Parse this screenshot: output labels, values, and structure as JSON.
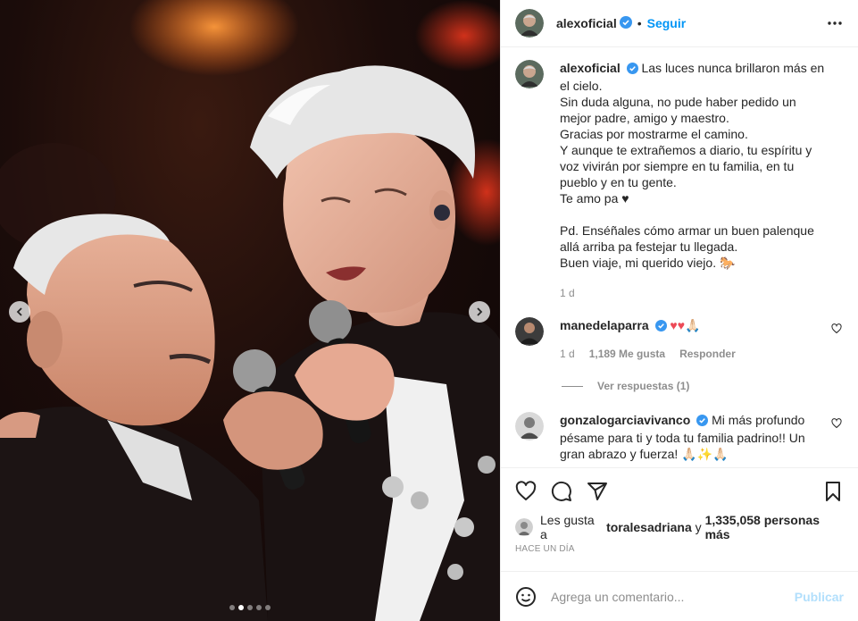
{
  "post": {
    "username": "alexoficial",
    "follow_label": "Seguir",
    "separator": "•",
    "more_icon": "more-horizontal-icon",
    "media": {
      "carousel_dots": 5,
      "active_dot": 2,
      "prev_icon": "chevron-left-icon",
      "next_icon": "chevron-right-icon"
    }
  },
  "caption": {
    "username": "alexoficial",
    "lines": [
      "Las luces nunca brillaron más en el cielo.",
      "Sin duda alguna, no pude haber pedido un mejor padre, amigo y maestro.",
      "Gracias por mostrarme el camino.",
      "Y aunque te extrañemos a diario, tu espíritu y voz vivirán por siempre en tu familia, en tu pueblo y en tu gente.",
      "Te amo pa ♥"
    ],
    "lines2": [
      "Pd. Enséñales cómo armar un buen palenque allá arriba pa festejar tu llegada.",
      "Buen viaje, mi querido viejo. 🐎"
    ],
    "time": "1 d"
  },
  "comments": [
    {
      "username": "manedelaparra",
      "text": "♥♥🙏🏻",
      "time": "1 d",
      "likes": "1,189 Me gusta",
      "reply": "Responder",
      "view_replies": "Ver respuestas (1)"
    },
    {
      "username": "gonzalogarciavivanco",
      "text": "Mi más profundo pésame para ti y toda tu familia padrino!! Un gran abrazo y fuerza! 🙏🏻✨🙏🏻"
    }
  ],
  "likes": {
    "prefix": "Les gusta a",
    "user": "toralesadriana",
    "conjunction": "y",
    "others": "1,335,058 personas más"
  },
  "timestamp": "HACE UN DÍA",
  "add_comment": {
    "placeholder": "Agrega un comentario...",
    "publish": "Publicar",
    "emoji_icon": "emoji-icon"
  },
  "colors": {
    "accent": "#0095f6",
    "verified": "#3897f0",
    "heart": "#ed4956",
    "muted": "#8e8e8e",
    "publish_disabled": "#b2dffc"
  }
}
